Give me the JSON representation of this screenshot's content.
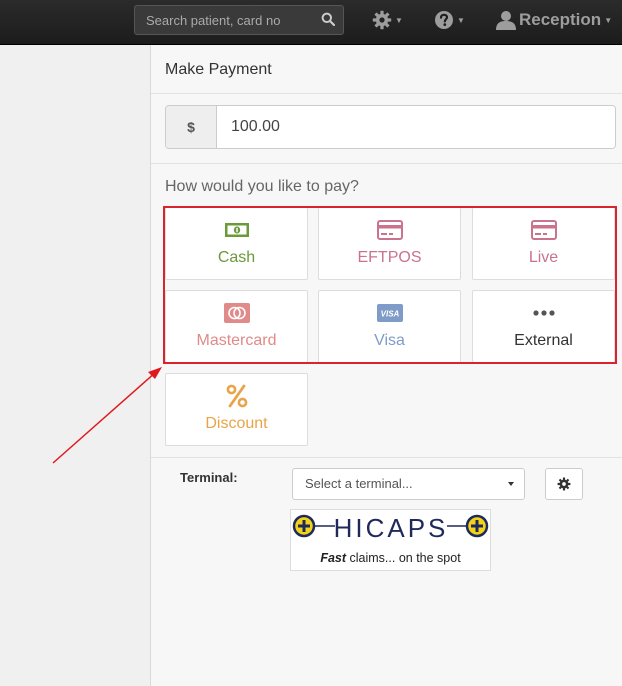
{
  "header": {
    "search_placeholder": "Search patient, card no",
    "user_label": "Reception"
  },
  "payment": {
    "title": "Make Payment",
    "currency_symbol": "$",
    "amount": "100.00",
    "question": "How would you like to pay?",
    "methods": [
      {
        "label": "Cash",
        "icon": "cash-icon",
        "color": "#6b9a3a"
      },
      {
        "label": "EFTPOS",
        "icon": "card-icon",
        "color": "#c9738e"
      },
      {
        "label": "Live",
        "icon": "card-icon",
        "color": "#c9738e"
      },
      {
        "label": "Mastercard",
        "icon": "mastercard-icon",
        "color": "#e08a8a"
      },
      {
        "label": "Visa",
        "icon": "visa-icon",
        "color": "#7e9cc7"
      },
      {
        "label": "External",
        "icon": "more-icon",
        "color": "#333333"
      },
      {
        "label": "Discount",
        "icon": "percent-icon",
        "color": "#e9a44a"
      }
    ]
  },
  "terminal": {
    "label": "Terminal:",
    "placeholder": "Select a terminal...",
    "brand": "HICAPS",
    "tagline_bold": "Fast",
    "tagline_rest": " claims... on the spot"
  },
  "colors": {
    "highlight": "#d9232d",
    "arrow": "#e0191e",
    "hicaps_yellow": "#f3d21a",
    "hicaps_navy": "#1f2a5a"
  }
}
